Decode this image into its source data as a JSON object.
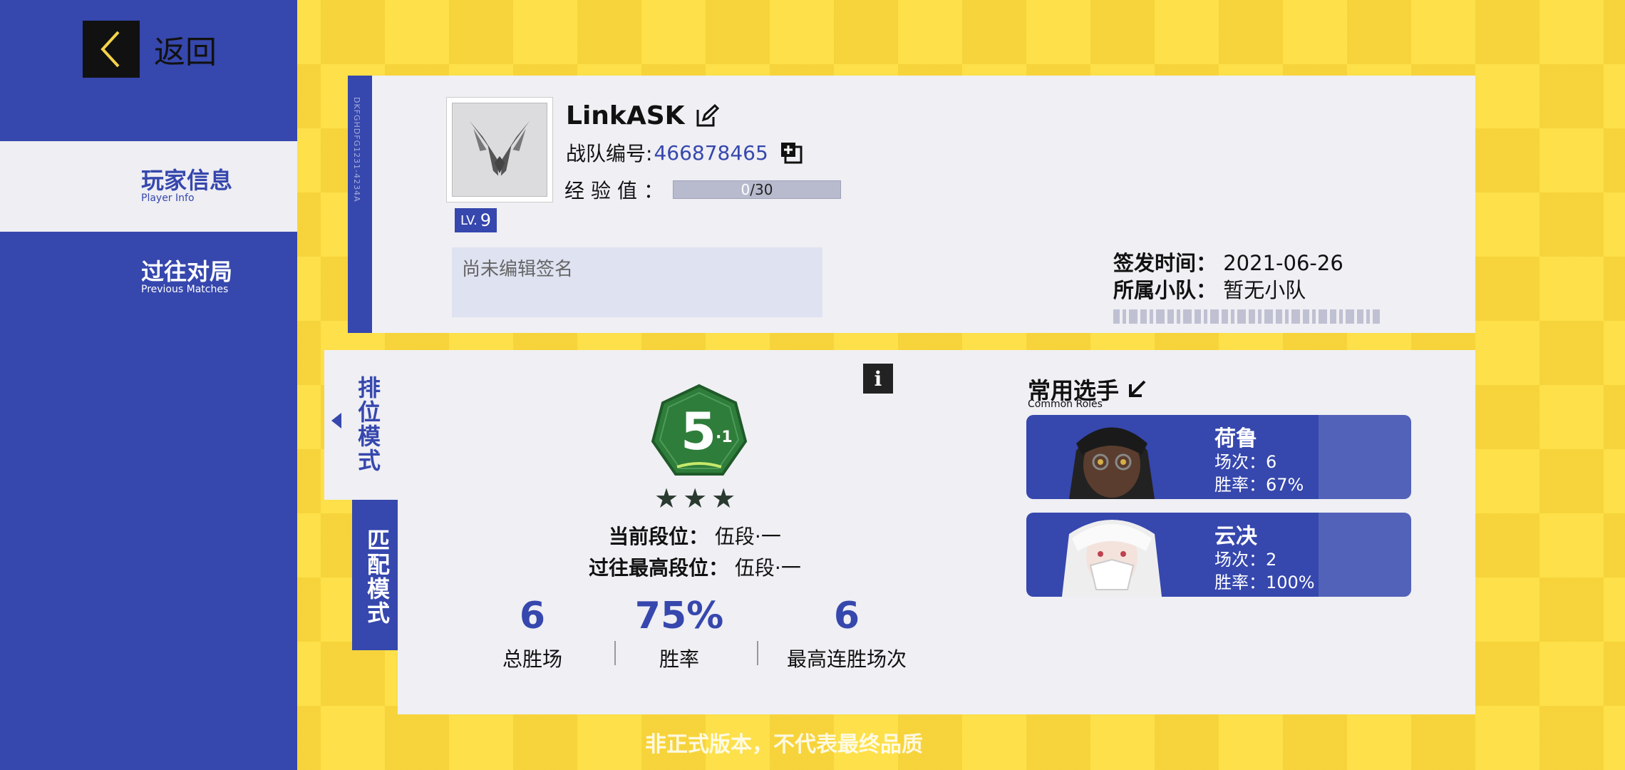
{
  "sidebar": {
    "back_label": "返回",
    "items": [
      {
        "label_zh": "玩家信息",
        "label_en": "Player Info",
        "active": true
      },
      {
        "label_zh": "过往对局",
        "label_en": "Previous Matches",
        "active": false
      }
    ]
  },
  "profile": {
    "card_code": "DKFGHDFG1231-4234A",
    "name": "LinkASK",
    "level_prefix": "LV.",
    "level": "9",
    "team_id_label": "战队编号:",
    "team_id": "466878465",
    "exp_label": "经验值：",
    "exp_current": "0",
    "exp_max": "/30",
    "signature_placeholder": "尚未编辑签名",
    "issue_label": "签发时间：",
    "issue_date": "2021-06-26",
    "squad_label": "所属小队：",
    "squad_value": "暂无小队"
  },
  "modes": {
    "rank": "排位模式",
    "match": "匹配模式"
  },
  "rank": {
    "number": "5",
    "sub": "·1",
    "stars": "★★★",
    "current_label": "当前段位：",
    "current_value": "伍段·一",
    "best_label": "过往最高段位：",
    "best_value": "伍段·一",
    "info_icon": "i"
  },
  "stats": [
    {
      "value": "6",
      "label": "总胜场"
    },
    {
      "value": "75%",
      "label": "胜率"
    },
    {
      "value": "6",
      "label": "最高连胜场次"
    }
  ],
  "roles": {
    "title_zh": "常用选手",
    "title_en": "Common Roles",
    "items": [
      {
        "name": "荷鲁",
        "games": "场次：6",
        "winrate": "胜率：67%"
      },
      {
        "name": "云决",
        "games": "场次：2",
        "winrate": "胜率：100%"
      }
    ]
  },
  "watermark": "非正式版本，不代表最终品质",
  "colors": {
    "primary_blue": "#3647ad",
    "background_yellow": "#fde04a",
    "card_bg": "#efeff4",
    "rank_green": "#2e7d3a"
  }
}
